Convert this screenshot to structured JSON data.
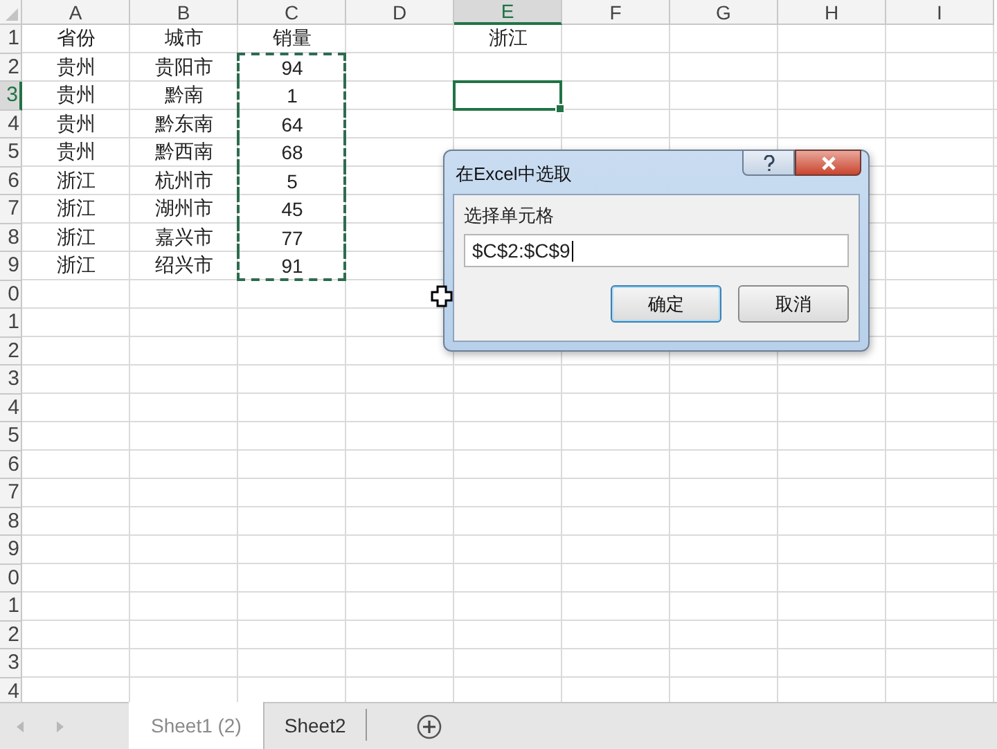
{
  "columns": [
    {
      "label": "A",
      "selected": false
    },
    {
      "label": "B",
      "selected": false
    },
    {
      "label": "C",
      "selected": false
    },
    {
      "label": "D",
      "selected": false
    },
    {
      "label": "E",
      "selected": true
    },
    {
      "label": "F",
      "selected": false
    },
    {
      "label": "G",
      "selected": false
    },
    {
      "label": "H",
      "selected": false
    },
    {
      "label": "I",
      "selected": false
    }
  ],
  "rows": [
    {
      "label": "1",
      "selected": false,
      "cells": {
        "A": {
          "text": "省份",
          "marquee": false
        },
        "B": {
          "text": "城市",
          "marquee": false
        },
        "C": {
          "text": "销量",
          "marquee": false
        },
        "E": {
          "text": "浙江",
          "marquee": false
        }
      }
    },
    {
      "label": "2",
      "selected": false,
      "cells": {
        "A": {
          "text": "贵州",
          "marquee": false
        },
        "B": {
          "text": "贵阳市",
          "marquee": false
        },
        "C": {
          "text": "94",
          "marquee": true
        }
      }
    },
    {
      "label": "3",
      "selected": true,
      "cells": {
        "A": {
          "text": "贵州",
          "marquee": false
        },
        "B": {
          "text": "黔南",
          "marquee": false
        },
        "C": {
          "text": "1",
          "marquee": true
        }
      }
    },
    {
      "label": "4",
      "selected": false,
      "cells": {
        "A": {
          "text": "贵州",
          "marquee": false
        },
        "B": {
          "text": "黔东南",
          "marquee": false
        },
        "C": {
          "text": "64",
          "marquee": true
        }
      }
    },
    {
      "label": "5",
      "selected": false,
      "cells": {
        "A": {
          "text": "贵州",
          "marquee": false
        },
        "B": {
          "text": "黔西南",
          "marquee": false
        },
        "C": {
          "text": "68",
          "marquee": true
        }
      }
    },
    {
      "label": "6",
      "selected": false,
      "cells": {
        "A": {
          "text": "浙江",
          "marquee": false
        },
        "B": {
          "text": "杭州市",
          "marquee": false
        },
        "C": {
          "text": "5",
          "marquee": true
        }
      }
    },
    {
      "label": "7",
      "selected": false,
      "cells": {
        "A": {
          "text": "浙江",
          "marquee": false
        },
        "B": {
          "text": "湖州市",
          "marquee": false
        },
        "C": {
          "text": "45",
          "marquee": true
        }
      }
    },
    {
      "label": "8",
      "selected": false,
      "cells": {
        "A": {
          "text": "浙江",
          "marquee": false
        },
        "B": {
          "text": "嘉兴市",
          "marquee": false
        },
        "C": {
          "text": "77",
          "marquee": true
        }
      }
    },
    {
      "label": "9",
      "selected": false,
      "cells": {
        "A": {
          "text": "浙江",
          "marquee": false
        },
        "B": {
          "text": "绍兴市",
          "marquee": false
        },
        "C": {
          "text": "91",
          "marquee": true
        }
      }
    },
    {
      "label": "0",
      "selected": false
    },
    {
      "label": "1",
      "selected": false
    },
    {
      "label": "2",
      "selected": false
    },
    {
      "label": "3",
      "selected": false
    },
    {
      "label": "4",
      "selected": false
    },
    {
      "label": "5",
      "selected": false
    },
    {
      "label": "6",
      "selected": false
    },
    {
      "label": "7",
      "selected": false
    },
    {
      "label": "8",
      "selected": false
    },
    {
      "label": "9",
      "selected": false
    },
    {
      "label": "0",
      "selected": false
    },
    {
      "label": "1",
      "selected": false
    },
    {
      "label": "2",
      "selected": false
    },
    {
      "label": "3",
      "selected": false
    },
    {
      "label": "4",
      "selected": false
    }
  ],
  "dialog": {
    "title": "在Excel中选取",
    "field_label": "选择单元格",
    "value": "$C$2:$C$9",
    "buttons": [
      {
        "label": "确定",
        "focused": true
      },
      {
        "label": "取消",
        "focused": false
      }
    ]
  },
  "sheet_tabs": [
    {
      "label": "Sheet1 (2)",
      "selected": true
    },
    {
      "label": "Sheet2",
      "selected": false
    }
  ]
}
